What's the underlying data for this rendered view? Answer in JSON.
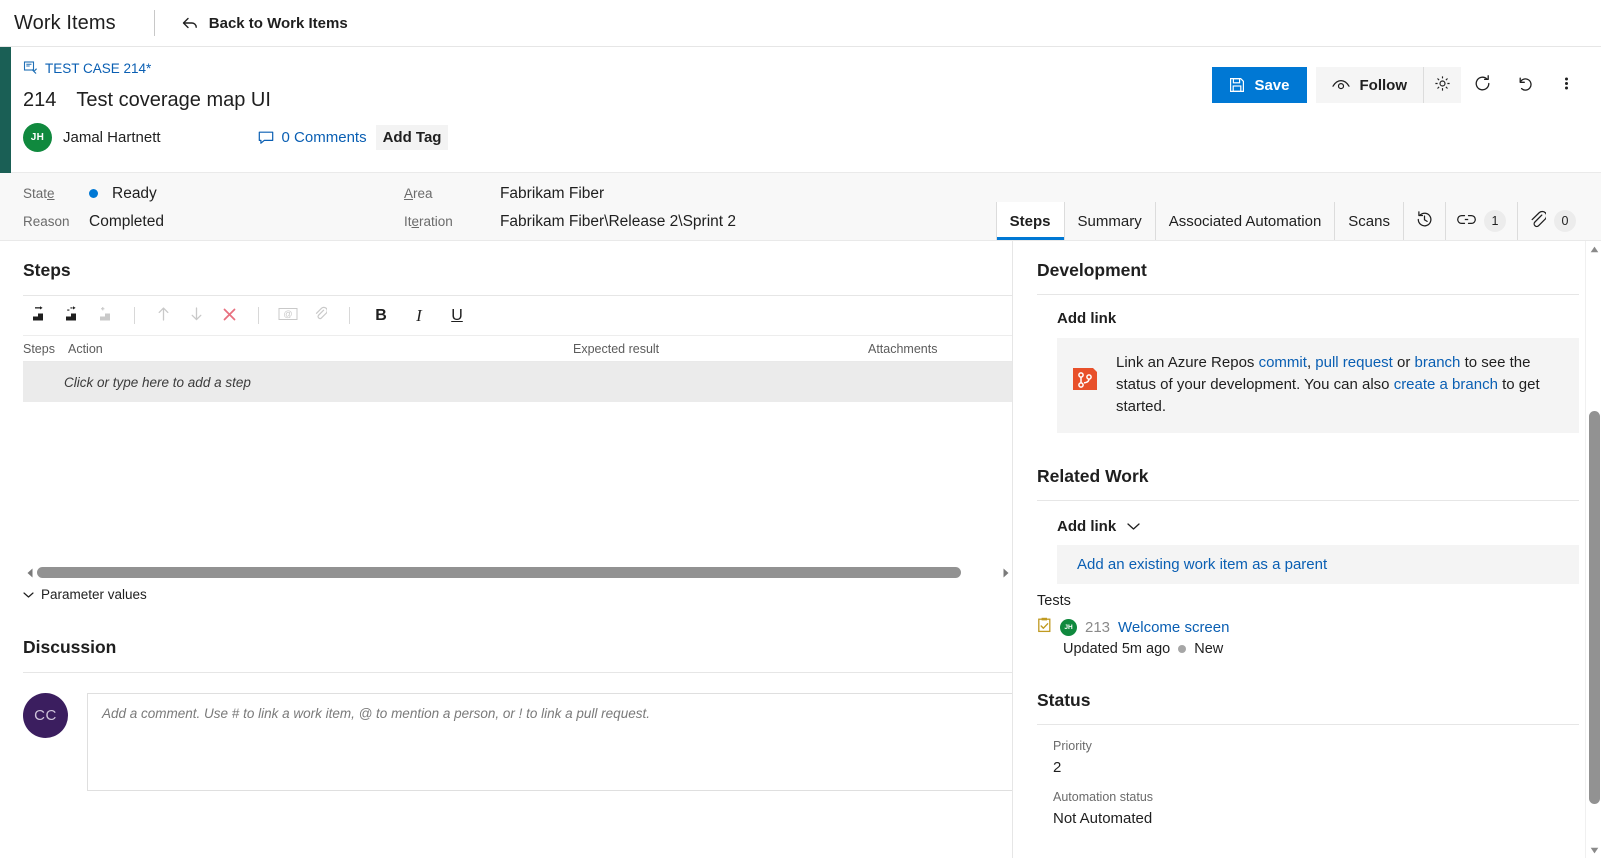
{
  "topnav": {
    "title": "Work Items",
    "back_label": "Back to Work Items"
  },
  "workitem": {
    "breadcrumb": "TEST CASE 214*",
    "id": "214",
    "title": "Test coverage map UI",
    "assignee": "Jamal Hartnett",
    "assignee_initials": "JH",
    "comments_label": "0 Comments",
    "add_tag_label": "Add Tag",
    "accent_color": "#1a5f55"
  },
  "toolbar": {
    "save_label": "Save",
    "follow_label": "Follow",
    "save_color": "#0078d4"
  },
  "fields": {
    "state_label": "State",
    "state_value": "Ready",
    "state_color": "#0078d4",
    "reason_label": "Reason",
    "reason_value": "Completed",
    "area_label": "Area",
    "area_value": "Fabrikam Fiber",
    "iteration_label": "Iteration",
    "iteration_value": "Fabrikam Fiber\\Release 2\\Sprint 2"
  },
  "tabs": [
    {
      "label": "Steps",
      "active": true
    },
    {
      "label": "Summary",
      "active": false
    },
    {
      "label": "Associated Automation",
      "active": false
    },
    {
      "label": "Scans",
      "active": false
    }
  ],
  "tab_icons": {
    "history": "history-icon",
    "links_badge": "1",
    "attachments_badge": "0"
  },
  "steps": {
    "heading": "Steps",
    "columns": {
      "steps": "Steps",
      "action": "Action",
      "expected": "Expected result",
      "attachments": "Attachments"
    },
    "empty_row": "Click or type here to add a step",
    "parameter_values": "Parameter values"
  },
  "discussion": {
    "heading": "Discussion",
    "avatar_initials": "CC",
    "placeholder": "Add a comment. Use # to link a work item, @ to mention a person, or ! to link a pull request."
  },
  "development": {
    "heading": "Development",
    "add_link": "Add link",
    "text_1": "Link an Azure Repos ",
    "link_commit": "commit",
    "text_comma": ", ",
    "link_pr": "pull request",
    "text_or": " or ",
    "link_branch": "branch",
    "text_2": " to see the status of your development. You can also ",
    "link_create_branch": "create a branch",
    "text_3": " to get started."
  },
  "related_work": {
    "heading": "Related Work",
    "add_link": "Add link",
    "parent_row": "Add an existing work item as a parent",
    "tests_label": "Tests",
    "test_item": {
      "number": "213",
      "name": "Welcome screen",
      "initials": "JH",
      "updated": "Updated 5m ago",
      "state": "New"
    }
  },
  "status": {
    "heading": "Status",
    "priority_label": "Priority",
    "priority_value": "2",
    "automation_label": "Automation status",
    "automation_value": "Not Automated"
  }
}
